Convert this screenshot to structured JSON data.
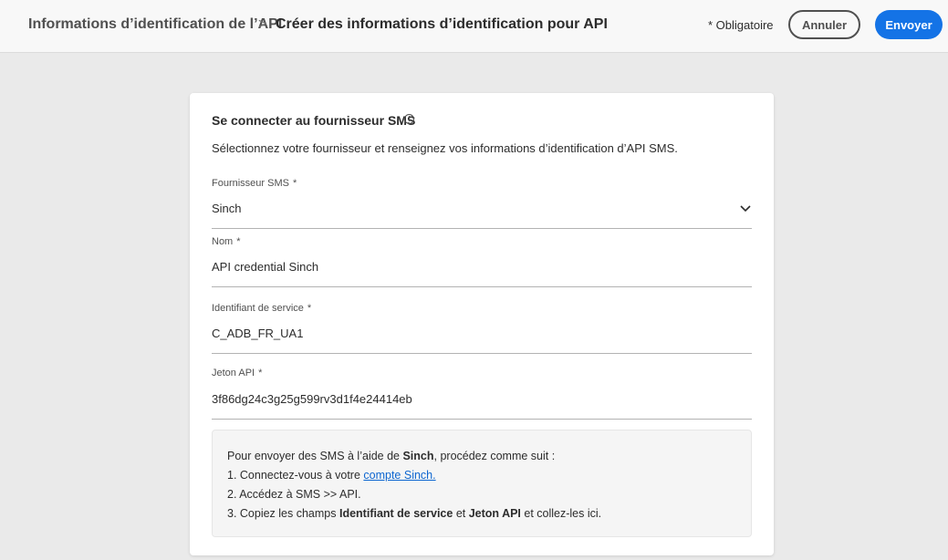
{
  "header": {
    "breadcrumb_parent": "Informations d’identification de l’API",
    "breadcrumb_separator": ">",
    "breadcrumb_current": "Créer des informations d’identification pour API",
    "required_note": "* Obligatoire",
    "cancel_label": "Annuler",
    "submit_label": "Envoyer"
  },
  "card": {
    "title": "Se connecter au fournisseur SMS",
    "info_icon_glyph": "i",
    "description": "Sélectionnez votre fournisseur et renseignez vos informations d’identification d’API SMS.",
    "fields": {
      "provider": {
        "label": "Fournisseur SMS",
        "required_mark": "*",
        "value": "Sinch"
      },
      "name": {
        "label": "Nom",
        "required_mark": "*",
        "value": "API credential Sinch"
      },
      "service_id": {
        "label": "Identifiant de service",
        "required_mark": "*",
        "value": "C_ADB_FR_UA1"
      },
      "api_token": {
        "label": "Jeton API",
        "required_mark": "*",
        "value": "3f86dg24c3g25g599rv3d1f4e24414eb"
      }
    },
    "help": {
      "intro_prefix": "Pour envoyer des SMS à l’aide de ",
      "intro_provider": "Sinch",
      "intro_suffix": ", procédez comme suit :",
      "step1_prefix": "1. Connectez-vous à votre ",
      "step1_link": "compte Sinch.",
      "step2": "2. Accédez à SMS >> API.",
      "step3_prefix": "3. Copiez les champs ",
      "step3_field1": "Identifiant de service",
      "step3_and": " et ",
      "step3_field2": "Jeton API",
      "step3_suffix": " et collez-les ici."
    }
  },
  "icons": {
    "chevron": "chevron-down-icon",
    "info": "info-icon"
  },
  "colors": {
    "accent": "#1473e6",
    "link": "#0d66d0",
    "background": "#eaeaea"
  }
}
